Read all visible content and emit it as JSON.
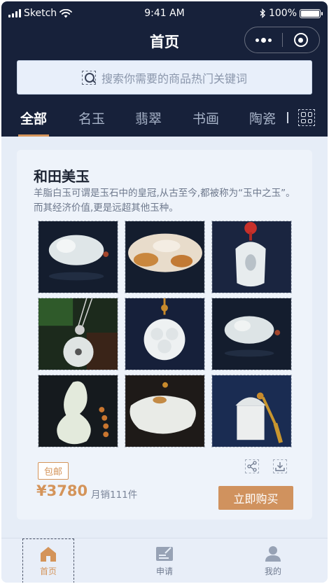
{
  "status_bar": {
    "carrier": "Sketch",
    "time": "9:41 AM",
    "battery": "100%"
  },
  "nav": {
    "title": "首页"
  },
  "search": {
    "placeholder": "搜索你需要的商品热门关键词"
  },
  "tabs": [
    {
      "label": "全部",
      "active": true
    },
    {
      "label": "名玉",
      "active": false
    },
    {
      "label": "翡翠",
      "active": false
    },
    {
      "label": "书画",
      "active": false
    },
    {
      "label": "陶瓷",
      "active": false
    }
  ],
  "product": {
    "title": "和田美玉",
    "description": "羊脂白玉可谓是玉石中的皇冠,从古至今,都被称为“玉中之玉”。而其经济价值,更是远超其他玉种。",
    "images": [
      "jade-ornament-1",
      "jade-pendant-russet",
      "jade-carving-red-cord",
      "jade-disc-pendant",
      "jade-peony-pendant",
      "jade-ornament-2",
      "jade-gourd-pendant",
      "jade-carving-long",
      "jade-seal-tassel"
    ],
    "tag": "包邮",
    "price": "¥3780",
    "sales": "月销111件",
    "buy_label": "立即购买"
  },
  "tabbar": [
    {
      "label": "首页",
      "icon": "home-icon",
      "active": true
    },
    {
      "label": "申请",
      "icon": "apply-icon",
      "active": false
    },
    {
      "label": "我的",
      "icon": "profile-icon",
      "active": false
    }
  ],
  "colors": {
    "accent": "#d4945a",
    "header_bg": "#17213a",
    "page_bg": "#e6edf7"
  }
}
